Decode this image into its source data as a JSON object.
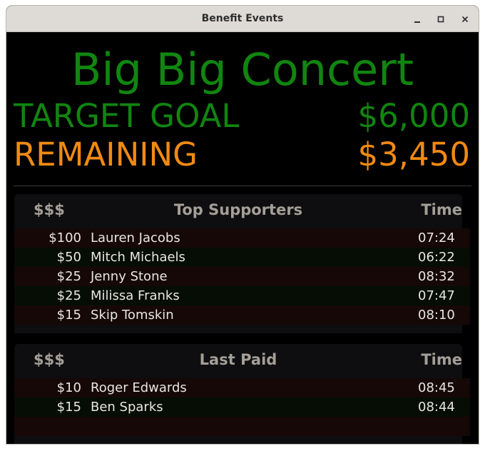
{
  "window": {
    "title": "Benefit Events"
  },
  "event": {
    "name": "Big Big Concert",
    "target_label": "TARGET GOAL",
    "target_value": "$6,000",
    "remaining_label": "REMAINING",
    "remaining_value": "$3,450"
  },
  "colors": {
    "goal": "#118510",
    "remaining": "#f18a13",
    "header_text": "#a49f97",
    "row_text": "#e9e6e1"
  },
  "top_supporters": {
    "headers": [
      "$$$",
      "Top Supporters",
      "Time"
    ],
    "rows": [
      {
        "amount": "$100",
        "name": "Lauren Jacobs",
        "time": "07:24"
      },
      {
        "amount": "$50",
        "name": "Mitch Michaels",
        "time": "06:22"
      },
      {
        "amount": "$25",
        "name": "Jenny Stone",
        "time": "08:32"
      },
      {
        "amount": "$25",
        "name": "Milissa Franks",
        "time": "07:47"
      },
      {
        "amount": "$15",
        "name": "Skip Tomskin",
        "time": "08:10"
      }
    ]
  },
  "last_paid": {
    "headers": [
      "$$$",
      "Last Paid",
      "Time"
    ],
    "rows": [
      {
        "amount": "$10",
        "name": "Roger Edwards",
        "time": "08:45"
      },
      {
        "amount": "$15",
        "name": "Ben Sparks",
        "time": "08:44"
      },
      {
        "amount": "",
        "name": "",
        "time": ""
      }
    ]
  }
}
